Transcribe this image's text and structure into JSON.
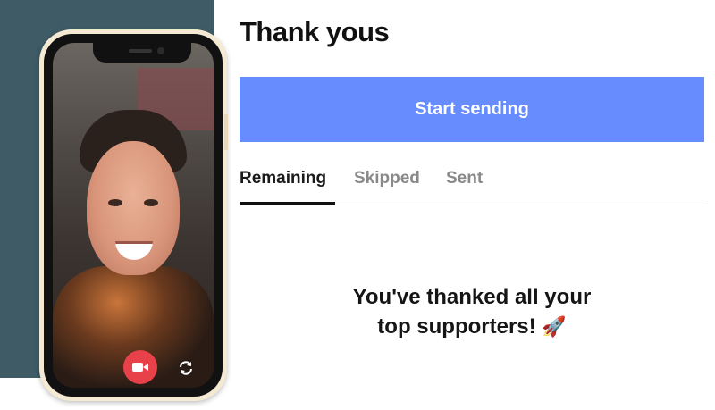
{
  "panel": {
    "title": "Thank yous",
    "start_button_label": "Start sending",
    "tabs": [
      {
        "label": "Remaining",
        "active": true
      },
      {
        "label": "Skipped",
        "active": false
      },
      {
        "label": "Sent",
        "active": false
      }
    ],
    "empty_message_line1": "You've thanked all your",
    "empty_message_line2": "top supporters!",
    "empty_message_emoji": "🚀"
  },
  "phone": {
    "record_icon": "video-camera-icon",
    "flip_icon": "camera-flip-icon"
  },
  "colors": {
    "accent": "#678cfd",
    "record": "#e8414a",
    "background_band": "#3f5b66"
  }
}
